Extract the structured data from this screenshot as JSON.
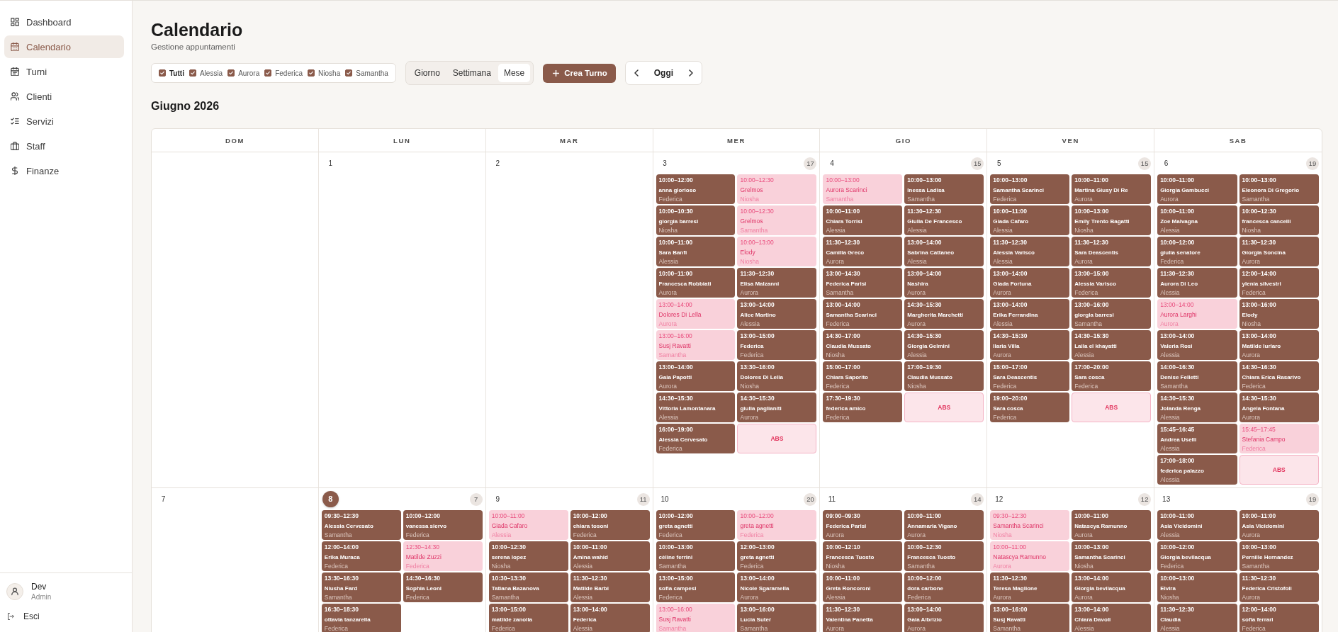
{
  "sidebar": {
    "items": [
      {
        "label": "Dashboard",
        "selected": false
      },
      {
        "label": "Calendario",
        "selected": true
      },
      {
        "label": "Turni",
        "selected": false
      },
      {
        "label": "Clienti",
        "selected": false
      },
      {
        "label": "Servizi",
        "selected": false
      },
      {
        "label": "Staff",
        "selected": false
      },
      {
        "label": "Finanze",
        "selected": false
      }
    ],
    "user": {
      "name": "Dev",
      "role": "Admin"
    },
    "logout": {
      "label": "Esci"
    }
  },
  "page": {
    "title": "Calendario",
    "subtitle": "Gestione appuntamenti"
  },
  "filters": [
    {
      "label": "Tutti",
      "kind": "all",
      "checked": true
    },
    {
      "label": "Alessia",
      "kind": "staff",
      "checked": true
    },
    {
      "label": "Aurora",
      "kind": "staff",
      "checked": true
    },
    {
      "label": "Federica",
      "kind": "staff",
      "checked": true
    },
    {
      "label": "Niosha",
      "kind": "staff",
      "checked": true
    },
    {
      "label": "Samantha",
      "kind": "staff",
      "checked": true
    }
  ],
  "view_tabs": [
    {
      "label": "Giorno",
      "selected": false
    },
    {
      "label": "Settimana",
      "selected": false
    },
    {
      "label": "Mese",
      "selected": true
    }
  ],
  "create_button": {
    "label": "Crea Turno"
  },
  "date_nav": {
    "today_label": "Oggi"
  },
  "month_title": "Giugno 2026",
  "calendar": {
    "weekdays": [
      "DOM",
      "LUN",
      "MAR",
      "MER",
      "GIO",
      "VEN",
      "SAB"
    ],
    "weeks": [
      {
        "days": [
          {
            "today": false
          },
          {
            "number": "1",
            "today": false
          },
          {
            "number": "2",
            "today": false
          },
          {
            "number": "3",
            "count": "17",
            "today": false,
            "events": [
              {
                "kind": "appointment",
                "time": "10:00–12:00",
                "client": "anna glorioso",
                "staff": "Federica",
                "pending": false
              },
              {
                "kind": "appointment",
                "time": "10:00–12:30",
                "client": "Grelmos",
                "staff": "Niosha",
                "pending": true
              },
              {
                "kind": "appointment",
                "time": "10:00–10:30",
                "client": "giorgia barresi",
                "staff": "Niosha",
                "pending": false
              },
              {
                "kind": "appointment",
                "time": "10:00–12:30",
                "client": "Grelmos",
                "staff": "Samantha",
                "pending": true
              },
              {
                "kind": "appointment",
                "time": "10:00–11:00",
                "client": "Sara Banfi",
                "staff": "Alessia",
                "pending": false
              },
              {
                "kind": "appointment",
                "time": "10:00–13:00",
                "client": "Elody",
                "staff": "Niosha",
                "pending": true
              },
              {
                "kind": "appointment",
                "time": "10:00–11:00",
                "client": "Francesca Robbiati",
                "staff": "Aurora",
                "pending": false
              },
              {
                "kind": "appointment",
                "time": "11:30–12:30",
                "client": "Elisa Malzanni",
                "staff": "Aurora",
                "pending": false
              },
              {
                "kind": "appointment",
                "time": "13:00–14:00",
                "client": "Dolores Di Lella",
                "staff": "Aurora",
                "pending": true
              },
              {
                "kind": "appointment",
                "time": "13:00–14:00",
                "client": "Alice Martino",
                "staff": "Alessia",
                "pending": false
              },
              {
                "kind": "appointment",
                "time": "13:00–16:00",
                "client": "Susj Ravatti",
                "staff": "Samantha",
                "pending": true
              },
              {
                "kind": "appointment",
                "time": "13:00–15:00",
                "client": "Federica",
                "staff": "Federica",
                "pending": false
              },
              {
                "kind": "appointment",
                "time": "13:00–14:00",
                "client": "Gaia Papotti",
                "staff": "Aurora",
                "pending": false
              },
              {
                "kind": "appointment",
                "time": "13:30–16:00",
                "client": "Dolores Di Lella",
                "staff": "Niosha",
                "pending": false
              },
              {
                "kind": "appointment",
                "time": "14:30–15:30",
                "client": "Vittoria Lamontanara",
                "staff": "Alessia",
                "pending": false
              },
              {
                "kind": "appointment",
                "time": "14:30–15:30",
                "client": "giulia paglianiti",
                "staff": "Aurora",
                "pending": false
              },
              {
                "kind": "appointment",
                "time": "16:00–19:00",
                "client": "Alessia Cervesato",
                "staff": "Federica",
                "pending": false
              },
              {
                "kind": "absence",
                "label": "ABS"
              }
            ]
          },
          {
            "number": "4",
            "count": "15",
            "today": false,
            "events": [
              {
                "kind": "appointment",
                "time": "10:00–13:00",
                "client": "Aurora Scarinci",
                "staff": "Samantha",
                "pending": true
              },
              {
                "kind": "appointment",
                "time": "10:00–13:00",
                "client": "Inessa Ladisa",
                "staff": "Samantha",
                "pending": false
              },
              {
                "kind": "appointment",
                "time": "10:00–11:00",
                "client": "Chiara Torrisi",
                "staff": "Alessia",
                "pending": false
              },
              {
                "kind": "appointment",
                "time": "11:30–12:30",
                "client": "Giulia De Francesco",
                "staff": "Alessia",
                "pending": false
              },
              {
                "kind": "appointment",
                "time": "11:30–12:30",
                "client": "Camilla Greco",
                "staff": "Aurora",
                "pending": false
              },
              {
                "kind": "appointment",
                "time": "13:00–14:00",
                "client": "Sabrina Cattaneo",
                "staff": "Alessia",
                "pending": false
              },
              {
                "kind": "appointment",
                "time": "13:00–14:30",
                "client": "Federica Parisi",
                "staff": "Samantha",
                "pending": false
              },
              {
                "kind": "appointment",
                "time": "13:00–14:00",
                "client": "Nashira",
                "staff": "Aurora",
                "pending": false
              },
              {
                "kind": "appointment",
                "time": "13:00–14:00",
                "client": "Samantha Scarinci",
                "staff": "Federica",
                "pending": false
              },
              {
                "kind": "appointment",
                "time": "14:30–15:30",
                "client": "Margherita Marchetti",
                "staff": "Aurora",
                "pending": false
              },
              {
                "kind": "appointment",
                "time": "14:30–17:00",
                "client": "Claudia Mussato",
                "staff": "Niosha",
                "pending": false
              },
              {
                "kind": "appointment",
                "time": "14:30–15:30",
                "client": "Giorgia Gelmini",
                "staff": "Alessia",
                "pending": false
              },
              {
                "kind": "appointment",
                "time": "15:00–17:00",
                "client": "Chiara Saporito",
                "staff": "Federica",
                "pending": false
              },
              {
                "kind": "appointment",
                "time": "17:00–19:30",
                "client": "Claudia Mussato",
                "staff": "Niosha",
                "pending": false
              },
              {
                "kind": "appointment",
                "time": "17:30–19:30",
                "client": "federica amico",
                "staff": "Federica",
                "pending": false
              },
              {
                "kind": "absence",
                "label": "ABS"
              }
            ]
          },
          {
            "number": "5",
            "count": "15",
            "today": false,
            "events": [
              {
                "kind": "appointment",
                "time": "10:00–13:00",
                "client": "Samantha Scarinci",
                "staff": "Federica",
                "pending": false
              },
              {
                "kind": "appointment",
                "time": "10:00–11:00",
                "client": "Martina Giusy Di Re",
                "staff": "Aurora",
                "pending": false
              },
              {
                "kind": "appointment",
                "time": "10:00–11:00",
                "client": "Giada Cafaro",
                "staff": "Alessia",
                "pending": false
              },
              {
                "kind": "appointment",
                "time": "10:00–13:00",
                "client": "Emily Trento Bagatti",
                "staff": "Niosha",
                "pending": false
              },
              {
                "kind": "appointment",
                "time": "11:30–12:30",
                "client": "Alessia Varisco",
                "staff": "Alessia",
                "pending": false
              },
              {
                "kind": "appointment",
                "time": "11:30–12:30",
                "client": "Sara Deascentis",
                "staff": "Aurora",
                "pending": false
              },
              {
                "kind": "appointment",
                "time": "13:00–14:00",
                "client": "Giada Fortuna",
                "staff": "Aurora",
                "pending": false
              },
              {
                "kind": "appointment",
                "time": "13:00–15:00",
                "client": "Alessia Varisco",
                "staff": "Federica",
                "pending": false
              },
              {
                "kind": "appointment",
                "time": "13:00–14:00",
                "client": "Erika Ferrandina",
                "staff": "Alessia",
                "pending": false
              },
              {
                "kind": "appointment",
                "time": "13:00–16:00",
                "client": "giorgia barresi",
                "staff": "Samantha",
                "pending": false
              },
              {
                "kind": "appointment",
                "time": "14:30–15:30",
                "client": "Ilaria Villa",
                "staff": "Aurora",
                "pending": false
              },
              {
                "kind": "appointment",
                "time": "14:30–15:30",
                "client": "Laila el khayatti",
                "staff": "Alessia",
                "pending": false
              },
              {
                "kind": "appointment",
                "time": "15:00–17:00",
                "client": "Sara Deascentis",
                "staff": "Federica",
                "pending": false
              },
              {
                "kind": "appointment",
                "time": "17:00–20:00",
                "client": "Sara cosca",
                "staff": "Federica",
                "pending": false
              },
              {
                "kind": "appointment",
                "time": "19:00–20:00",
                "client": "Sara cosca",
                "staff": "Federica",
                "pending": false
              },
              {
                "kind": "absence",
                "label": "ABS"
              }
            ]
          },
          {
            "number": "6",
            "count": "19",
            "today": false,
            "events": [
              {
                "kind": "appointment",
                "time": "10:00–11:00",
                "client": "Giorgia Gambucci",
                "staff": "Aurora",
                "pending": false
              },
              {
                "kind": "appointment",
                "time": "10:00–13:00",
                "client": "Eleonora Di Gregorio",
                "staff": "Samantha",
                "pending": false
              },
              {
                "kind": "appointment",
                "time": "10:00–11:00",
                "client": "Zoe Malvagna",
                "staff": "Alessia",
                "pending": false
              },
              {
                "kind": "appointment",
                "time": "10:00–12:30",
                "client": "francesca cancelli",
                "staff": "Niosha",
                "pending": false
              },
              {
                "kind": "appointment",
                "time": "10:00–12:00",
                "client": "giulia senatore",
                "staff": "Federica",
                "pending": false
              },
              {
                "kind": "appointment",
                "time": "11:30–12:30",
                "client": "Giorgia Soncina",
                "staff": "Aurora",
                "pending": false
              },
              {
                "kind": "appointment",
                "time": "11:30–12:30",
                "client": "Aurora Di Leo",
                "staff": "Alessia",
                "pending": false
              },
              {
                "kind": "appointment",
                "time": "12:00–14:00",
                "client": "ylenia silvestri",
                "staff": "Federica",
                "pending": false
              },
              {
                "kind": "appointment",
                "time": "13:00–14:00",
                "client": "Aurora Larghi",
                "staff": "Aurora",
                "pending": true
              },
              {
                "kind": "appointment",
                "time": "13:00–16:00",
                "client": "Elody",
                "staff": "Niosha",
                "pending": false
              },
              {
                "kind": "appointment",
                "time": "13:00–14:00",
                "client": "Valeria Rosi",
                "staff": "Alessia",
                "pending": false
              },
              {
                "kind": "appointment",
                "time": "13:00–14:00",
                "client": "Matilde Iurlaro",
                "staff": "Aurora",
                "pending": false
              },
              {
                "kind": "appointment",
                "time": "14:00–16:30",
                "client": "Denise Felletti",
                "staff": "Samantha",
                "pending": false
              },
              {
                "kind": "appointment",
                "time": "14:30–16:30",
                "client": "Chiara Erica Rasarivo",
                "staff": "Federica",
                "pending": false
              },
              {
                "kind": "appointment",
                "time": "14:30–15:30",
                "client": "Jolanda Renga",
                "staff": "Alessia",
                "pending": false
              },
              {
                "kind": "appointment",
                "time": "14:30–15:30",
                "client": "Angela Fontana",
                "staff": "Aurora",
                "pending": false
              },
              {
                "kind": "appointment",
                "time": "15:45–16:45",
                "client": "Andrea Uselli",
                "staff": "Alessia",
                "pending": false
              },
              {
                "kind": "appointment",
                "time": "15:45–17:45",
                "client": "Stefania Campo",
                "staff": "Federica",
                "pending": true
              },
              {
                "kind": "appointment",
                "time": "17:00–18:00",
                "client": "federica palazzo",
                "staff": "Alessia",
                "pending": false
              },
              {
                "kind": "absence",
                "label": "ABS"
              }
            ]
          }
        ]
      },
      {
        "days": [
          {
            "number": "7",
            "today": false
          },
          {
            "number": "8",
            "count": "7",
            "today": true,
            "events": [
              {
                "kind": "appointment",
                "time": "09:30–12:30",
                "client": "Alessia Cervesato",
                "staff": "Samantha",
                "pending": false
              },
              {
                "kind": "appointment",
                "time": "10:00–12:00",
                "client": "vanessa siervo",
                "staff": "Federica",
                "pending": false
              },
              {
                "kind": "appointment",
                "time": "12:00–14:00",
                "client": "Erika Muraca",
                "staff": "Federica",
                "pending": false
              },
              {
                "kind": "appointment",
                "time": "12:30–14:30",
                "client": "Matilde Zuzzi",
                "staff": "Federica",
                "pending": true
              },
              {
                "kind": "appointment",
                "time": "13:30–16:30",
                "client": "Niusha Fard",
                "staff": "Samantha",
                "pending": false
              },
              {
                "kind": "appointment",
                "time": "14:30–16:30",
                "client": "Sophia Leoni",
                "staff": "Federica",
                "pending": false
              },
              {
                "kind": "appointment",
                "time": "16:30–18:30",
                "client": "ottavia tanzarella",
                "staff": "Federica",
                "pending": false
              }
            ]
          },
          {
            "number": "9",
            "count": "11",
            "today": false,
            "events": [
              {
                "kind": "appointment",
                "time": "10:00–11:00",
                "client": "Giada Cafaro",
                "staff": "Alessia",
                "pending": true
              },
              {
                "kind": "appointment",
                "time": "10:00–12:00",
                "client": "chiara tosoni",
                "staff": "Federica",
                "pending": false
              },
              {
                "kind": "appointment",
                "time": "10:00–12:30",
                "client": "serena lopez",
                "staff": "Niosha",
                "pending": false
              },
              {
                "kind": "appointment",
                "time": "10:00–11:00",
                "client": "Amina wahid",
                "staff": "Alessia",
                "pending": false
              },
              {
                "kind": "appointment",
                "time": "10:30–13:30",
                "client": "Tatiana Bazanova",
                "staff": "Samantha",
                "pending": false
              },
              {
                "kind": "appointment",
                "time": "11:30–12:30",
                "client": "Matilde Barbi",
                "staff": "Alessia",
                "pending": false
              },
              {
                "kind": "appointment",
                "time": "13:00–15:00",
                "client": "matilde zanolla",
                "staff": "Federica",
                "pending": false
              },
              {
                "kind": "appointment",
                "time": "13:00–14:00",
                "client": "Federica",
                "staff": "Alessia",
                "pending": false
              }
            ]
          },
          {
            "number": "10",
            "count": "20",
            "today": false,
            "events": [
              {
                "kind": "appointment",
                "time": "10:00–12:00",
                "client": "greta agnetti",
                "staff": "Federica",
                "pending": false
              },
              {
                "kind": "appointment",
                "time": "10:00–12:00",
                "client": "greta agnetti",
                "staff": "Federica",
                "pending": true
              },
              {
                "kind": "appointment",
                "time": "10:00–13:00",
                "client": "cèline ferrini",
                "staff": "Samantha",
                "pending": false
              },
              {
                "kind": "appointment",
                "time": "12:00–13:00",
                "client": "greta agnetti",
                "staff": "Federica",
                "pending": false
              },
              {
                "kind": "appointment",
                "time": "13:00–15:00",
                "client": "sofia campesi",
                "staff": "Federica",
                "pending": false
              },
              {
                "kind": "appointment",
                "time": "13:00–14:00",
                "client": "Nicole Sgaramella",
                "staff": "Aurora",
                "pending": false
              },
              {
                "kind": "appointment",
                "time": "13:00–16:00",
                "client": "Susj Ravatti",
                "staff": "Samantha",
                "pending": true
              },
              {
                "kind": "appointment",
                "time": "13:00–16:00",
                "client": "Lucia Suter",
                "staff": "Samantha",
                "pending": false
              }
            ]
          },
          {
            "number": "11",
            "count": "14",
            "today": false,
            "events": [
              {
                "kind": "appointment",
                "time": "09:00–09:30",
                "client": "Federica Parisi",
                "staff": "Aurora",
                "pending": false
              },
              {
                "kind": "appointment",
                "time": "10:00–11:00",
                "client": "Annamaria Vigano",
                "staff": "Aurora",
                "pending": false
              },
              {
                "kind": "appointment",
                "time": "10:00–12:10",
                "client": "Francesca Tuosto",
                "staff": "Niosha",
                "pending": false
              },
              {
                "kind": "appointment",
                "time": "10:00–12:30",
                "client": "Francesca Tuosto",
                "staff": "Samantha",
                "pending": false
              },
              {
                "kind": "appointment",
                "time": "10:00–11:00",
                "client": "Greta Roncoroni",
                "staff": "Alessia",
                "pending": false
              },
              {
                "kind": "appointment",
                "time": "10:00–12:00",
                "client": "dora carbone",
                "staff": "Federica",
                "pending": false
              },
              {
                "kind": "appointment",
                "time": "11:30–12:30",
                "client": "Valentina Panetta",
                "staff": "Aurora",
                "pending": false
              },
              {
                "kind": "appointment",
                "time": "13:00–14:00",
                "client": "Gaia Albrizio",
                "staff": "Aurora",
                "pending": false
              }
            ]
          },
          {
            "number": "12",
            "count": "12",
            "today": false,
            "events": [
              {
                "kind": "appointment",
                "time": "09:30–12:30",
                "client": "Samantha Scarinci",
                "staff": "Niosha",
                "pending": true
              },
              {
                "kind": "appointment",
                "time": "10:00–11:00",
                "client": "Natascya Ramunno",
                "staff": "Aurora",
                "pending": false
              },
              {
                "kind": "appointment",
                "time": "10:00–11:00",
                "client": "Natascya Ramunno",
                "staff": "Aurora",
                "pending": true
              },
              {
                "kind": "appointment",
                "time": "10:00–13:00",
                "client": "Samantha Scarinci",
                "staff": "Niosha",
                "pending": false
              },
              {
                "kind": "appointment",
                "time": "11:30–12:30",
                "client": "Teresa Maglione",
                "staff": "Aurora",
                "pending": false
              },
              {
                "kind": "appointment",
                "time": "13:00–14:00",
                "client": "Giorgia bevilacqua",
                "staff": "Aurora",
                "pending": false
              },
              {
                "kind": "appointment",
                "time": "13:00–16:00",
                "client": "Susj Ravatti",
                "staff": "Samantha",
                "pending": false
              },
              {
                "kind": "appointment",
                "time": "13:00–14:00",
                "client": "Chiara Davoli",
                "staff": "Alessia",
                "pending": false
              }
            ]
          },
          {
            "number": "13",
            "count": "19",
            "today": false,
            "events": [
              {
                "kind": "appointment",
                "time": "10:00–11:00",
                "client": "Asia Vicidomini",
                "staff": "Alessia",
                "pending": false
              },
              {
                "kind": "appointment",
                "time": "10:00–11:00",
                "client": "Asia Vicidomini",
                "staff": "Aurora",
                "pending": false
              },
              {
                "kind": "appointment",
                "time": "10:00–12:00",
                "client": "Giorgia bevilacqua",
                "staff": "Federica",
                "pending": false
              },
              {
                "kind": "appointment",
                "time": "10:00–13:00",
                "client": "Pernille Hernandez",
                "staff": "Samantha",
                "pending": false
              },
              {
                "kind": "appointment",
                "time": "10:00–13:00",
                "client": "Elvira",
                "staff": "Niosha",
                "pending": false
              },
              {
                "kind": "appointment",
                "time": "11:30–12:30",
                "client": "Federica Cristofoli",
                "staff": "Aurora",
                "pending": false
              },
              {
                "kind": "appointment",
                "time": "11:30–12:30",
                "client": "Claudia",
                "staff": "Alessia",
                "pending": false
              },
              {
                "kind": "appointment",
                "time": "12:00–14:00",
                "client": "sofia ferrari",
                "staff": "Federica",
                "pending": false
              }
            ]
          }
        ]
      }
    ]
  }
}
